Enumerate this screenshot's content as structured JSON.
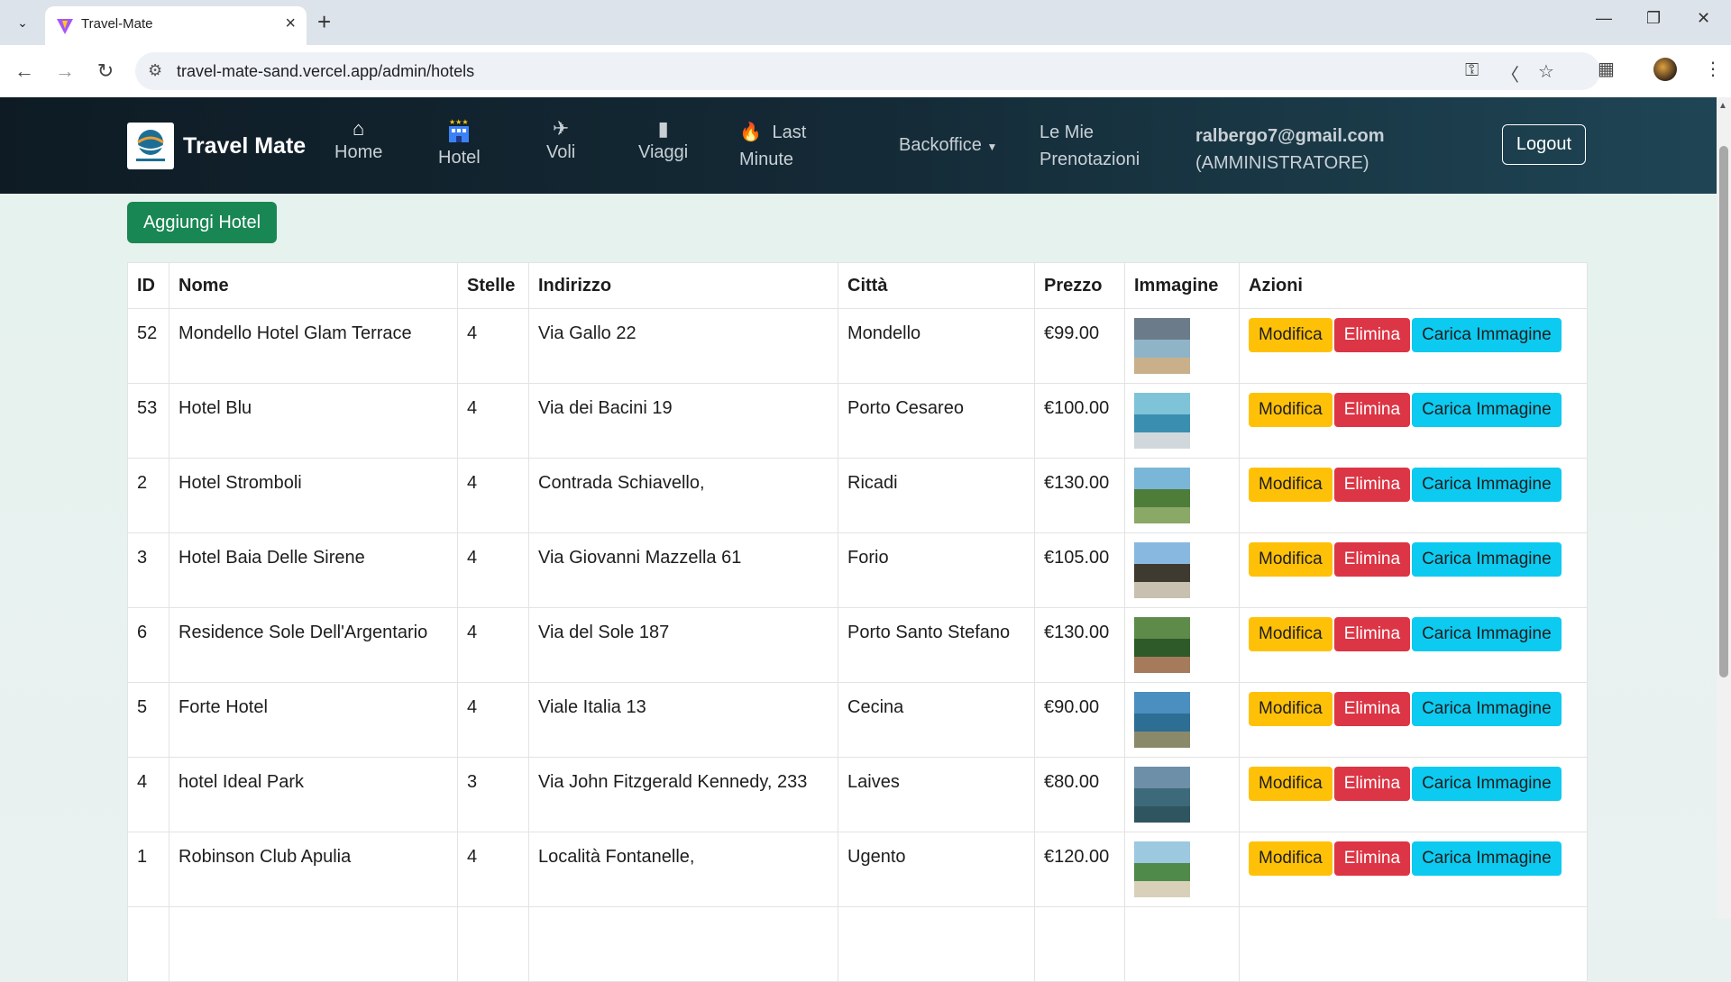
{
  "browser": {
    "tab_title": "Travel-Mate",
    "url": "travel-mate-sand.vercel.app/admin/hotels"
  },
  "navbar": {
    "brand": "Travel Mate",
    "items": [
      {
        "label": "Home",
        "icon": "home-icon"
      },
      {
        "label": "Hotel",
        "icon": "hotel-icon"
      },
      {
        "label": "Voli",
        "icon": "plane-icon"
      },
      {
        "label": "Viaggi",
        "icon": "luggage-icon"
      }
    ],
    "last_minute_line1": "Last",
    "last_minute_line2": "Minute",
    "backoffice": "Backoffice",
    "mie_line1": "Le Mie",
    "mie_line2": "Prenotazioni",
    "user_email": "ralbergo7@gmail.com",
    "user_role": "(AMMINISTRATORE)",
    "logout": "Logout"
  },
  "main": {
    "add_button": "Aggiungi Hotel",
    "columns": [
      "ID",
      "Nome",
      "Stelle",
      "Indirizzo",
      "Città",
      "Prezzo",
      "Immagine",
      "Azioni"
    ],
    "actions": {
      "edit": "Modifica",
      "delete": "Elimina",
      "upload": "Carica Immagine"
    },
    "hotels": [
      {
        "id": "52",
        "nome": "Mondello Hotel Glam Terrace",
        "stelle": "4",
        "indirizzo": "Via Gallo 22",
        "citta": "Mondello",
        "prezzo": "€99.00"
      },
      {
        "id": "53",
        "nome": "Hotel Blu",
        "stelle": "4",
        "indirizzo": "Via dei Bacini 19",
        "citta": "Porto Cesareo",
        "prezzo": "€100.00"
      },
      {
        "id": "2",
        "nome": "Hotel Stromboli",
        "stelle": "4",
        "indirizzo": "Contrada Schiavello,",
        "citta": "Ricadi",
        "prezzo": "€130.00"
      },
      {
        "id": "3",
        "nome": "Hotel Baia Delle Sirene",
        "stelle": "4",
        "indirizzo": "Via Giovanni Mazzella 61",
        "citta": "Forio",
        "prezzo": "€105.00"
      },
      {
        "id": "6",
        "nome": "Residence Sole Dell'Argentario",
        "stelle": "4",
        "indirizzo": "Via del Sole 187",
        "citta": "Porto Santo Stefano",
        "prezzo": "€130.00"
      },
      {
        "id": "5",
        "nome": "Forte Hotel",
        "stelle": "4",
        "indirizzo": "Viale Italia 13",
        "citta": "Cecina",
        "prezzo": "€90.00"
      },
      {
        "id": "4",
        "nome": "hotel Ideal Park",
        "stelle": "3",
        "indirizzo": "Via John Fitzgerald Kennedy, 233",
        "citta": "Laives",
        "prezzo": "€80.00"
      },
      {
        "id": "1",
        "nome": "Robinson Club Apulia",
        "stelle": "4",
        "indirizzo": "Località Fontanelle,",
        "citta": "Ugento",
        "prezzo": "€120.00"
      }
    ]
  }
}
